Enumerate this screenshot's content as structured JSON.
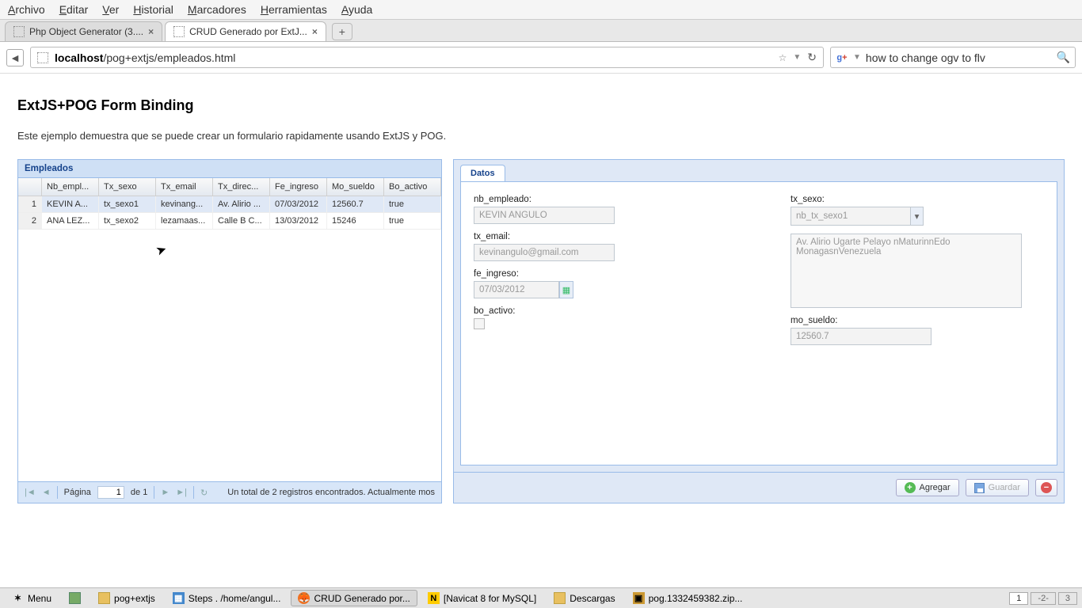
{
  "menubar": [
    "Archivo",
    "Editar",
    "Ver",
    "Historial",
    "Marcadores",
    "Herramientas",
    "Ayuda"
  ],
  "tabs": [
    {
      "title": "Php Object Generator (3....",
      "active": false
    },
    {
      "title": "CRUD Generado por ExtJ...",
      "active": true
    }
  ],
  "url": {
    "domain": "localhost",
    "path": "/pog+extjs/empleados.html"
  },
  "search": {
    "text": "how to change ogv to flv"
  },
  "page": {
    "title": "ExtJS+POG Form Binding",
    "subtitle": "Este ejemplo demuestra que se puede crear un formulario rapidamente usando ExtJS y POG."
  },
  "grid": {
    "title": "Empleados",
    "columns": [
      "",
      "Nb_empl...",
      "Tx_sexo",
      "Tx_email",
      "Tx_direc...",
      "Fe_ingreso",
      "Mo_sueldo",
      "Bo_activo"
    ],
    "rows": [
      {
        "num": "1",
        "cells": [
          "KEVIN A...",
          "tx_sexo1",
          "kevinang...",
          "Av. Alirio ...",
          "07/03/2012",
          "12560.7",
          "true"
        ],
        "selected": true
      },
      {
        "num": "2",
        "cells": [
          "ANA LEZ...",
          "tx_sexo2",
          "lezamaas...",
          "Calle B C...",
          "13/03/2012",
          "15246",
          "true"
        ],
        "selected": false
      }
    ],
    "paging": {
      "label_page": "Página",
      "page": "1",
      "of": "de 1",
      "status": "Un total de 2 registros encontrados. Actualmente mos"
    }
  },
  "form": {
    "tab": "Datos",
    "fields": {
      "nb_empleado": {
        "label": "nb_empleado:",
        "value": "KEVIN ANGULO"
      },
      "tx_email": {
        "label": "tx_email:",
        "value": "kevinangulo@gmail.com"
      },
      "fe_ingreso": {
        "label": "fe_ingreso:",
        "value": "07/03/2012"
      },
      "bo_activo": {
        "label": "bo_activo:"
      },
      "tx_sexo": {
        "label": "tx_sexo:",
        "value": "nb_tx_sexo1"
      },
      "direccion": {
        "value": "Av. Alirio Ugarte Pelayo nMaturinnEdo MonagasnVenezuela"
      },
      "mo_sueldo": {
        "label": "mo_sueldo:",
        "value": "12560.7"
      }
    },
    "buttons": {
      "agregar": "Agregar",
      "guardar": "Guardar"
    }
  },
  "taskbar": {
    "menu": "Menu",
    "items": [
      {
        "label": "pog+extjs",
        "icon": "folder"
      },
      {
        "label": "Steps . /home/angul...",
        "icon": "app"
      },
      {
        "label": "CRUD Generado por...",
        "icon": "ff",
        "active": true
      },
      {
        "label": "[Navicat 8 for MySQL]",
        "icon": "app"
      },
      {
        "label": "Descargas",
        "icon": "folder"
      },
      {
        "label": "pog.1332459382.zip...",
        "icon": "zip"
      }
    ],
    "workspaces": [
      "1",
      "-2-",
      "3"
    ]
  }
}
